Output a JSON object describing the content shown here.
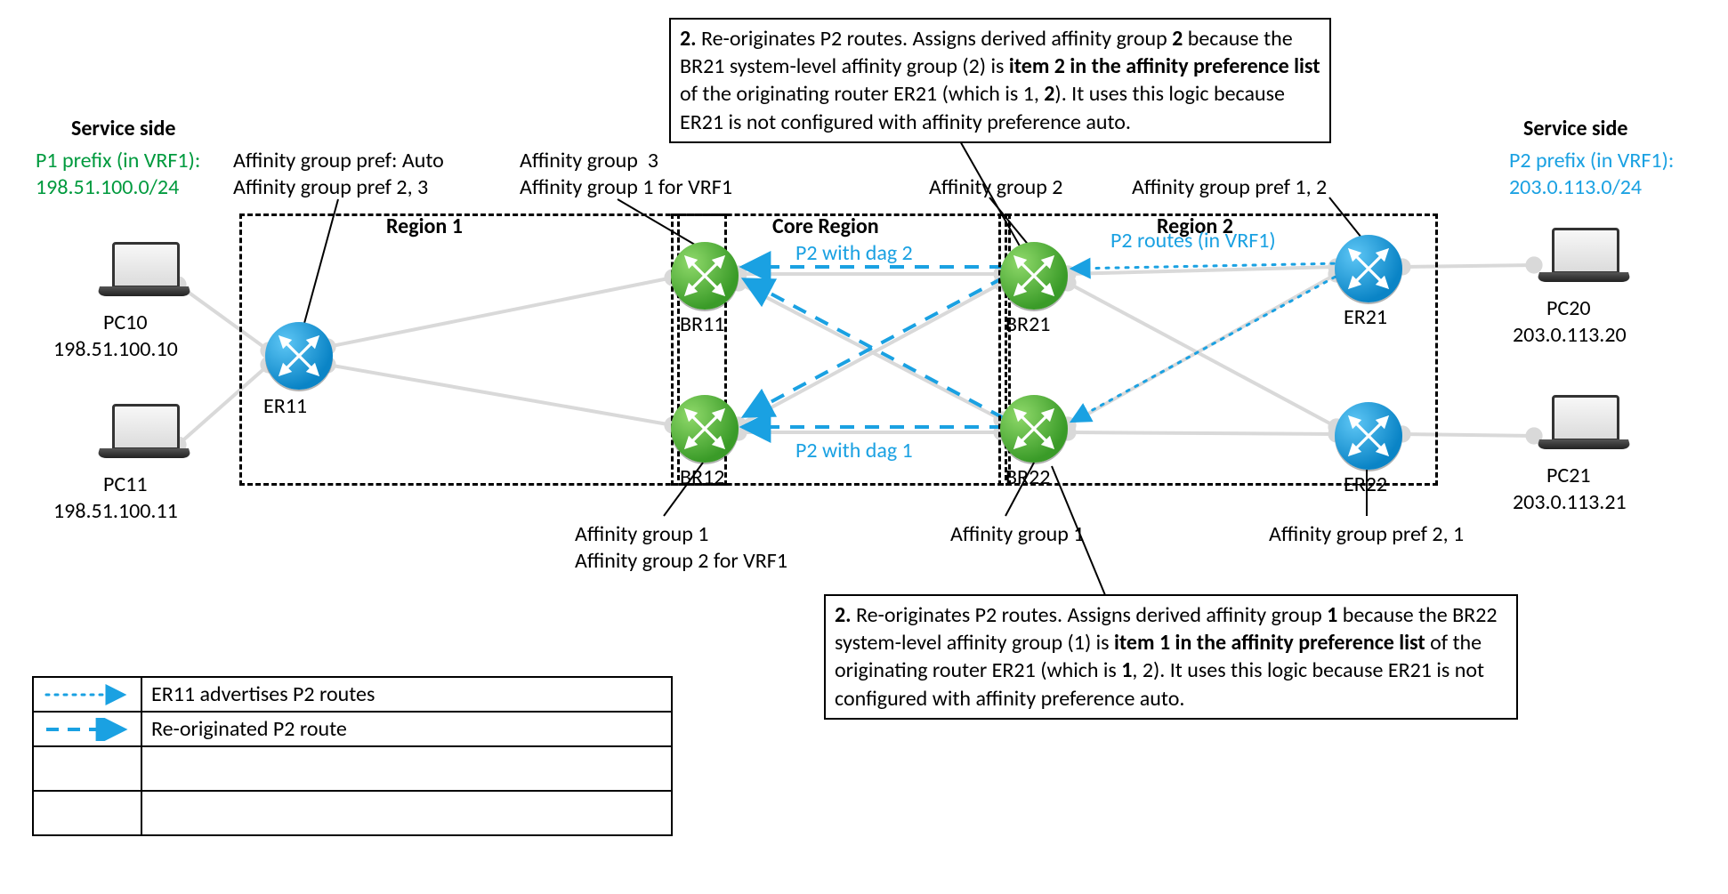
{
  "headings": {
    "service_left": "Service side",
    "service_right": "Service side",
    "region1": "Region 1",
    "core": "Core Region",
    "region2": "Region 2"
  },
  "prefixes": {
    "p1_line1": "P1 prefix (in VRF1):",
    "p1_line2": "198.51.100.0/24",
    "p2_line1": "P2 prefix (in VRF1):",
    "p2_line2": "203.0.113.0/24"
  },
  "devices": {
    "pc10": {
      "name": "PC10",
      "ip": "198.51.100.10"
    },
    "pc11": {
      "name": "PC11",
      "ip": "198.51.100.11"
    },
    "pc20": {
      "name": "PC20",
      "ip": "203.0.113.20"
    },
    "pc21": {
      "name": "PC21",
      "ip": "203.0.113.21"
    },
    "er11": "ER11",
    "er21": "ER21",
    "er22": "ER22",
    "br11": "BR11",
    "br12": "BR12",
    "br21": "BR21",
    "br22": "BR22"
  },
  "affinity": {
    "er11_l1": "Affinity group pref: Auto",
    "er11_l2": "Affinity group pref 2, 3",
    "br11_l1": "Affinity group  3",
    "br11_l2": "Affinity group 1 for VRF1",
    "br12_l1": "Affinity group 1",
    "br12_l2": "Affinity group 2 for VRF1",
    "br21": "Affinity group 2",
    "br22": "Affinity group 1",
    "er21": "Affinity group pref 1, 2",
    "er22": "Affinity group pref 2, 1"
  },
  "flows": {
    "p2_dag2": "P2 with dag 2",
    "p2_dag1": "P2 with dag 1",
    "p2_routes": "P2 routes (in VRF1)"
  },
  "callouts": {
    "top": {
      "step": "2.",
      "before": " Re-originates P2 routes. Assigns derived affinity group ",
      "grp": "2",
      "mid1": " because\nthe BR21 system-level affinity group (2) is ",
      "bold1": "item 2 in the affinity\npreference list",
      "mid2": " of the originating router ER21 (which is 1, ",
      "grp2": "2",
      "tail": "). It uses\nthis logic because ER21 is not configured with affinity preference auto."
    },
    "bottom": {
      "step": "2.",
      "before": " Re-originates P2 routes. Assigns derived affinity group ",
      "grp": "1",
      "mid1": " because the\nBR22 system-level affinity group (1) is ",
      "bold1": "item 1 in the affinity preference\nlist",
      "mid2": " of the originating router ER21 (which is ",
      "grp2": "1",
      "tail": ", 2). It uses this logic\nbecause ER21 is not configured with affinity preference auto."
    }
  },
  "legend": {
    "row1": "ER11 advertises P2 routes",
    "row2": "Re-originated P2 route"
  }
}
